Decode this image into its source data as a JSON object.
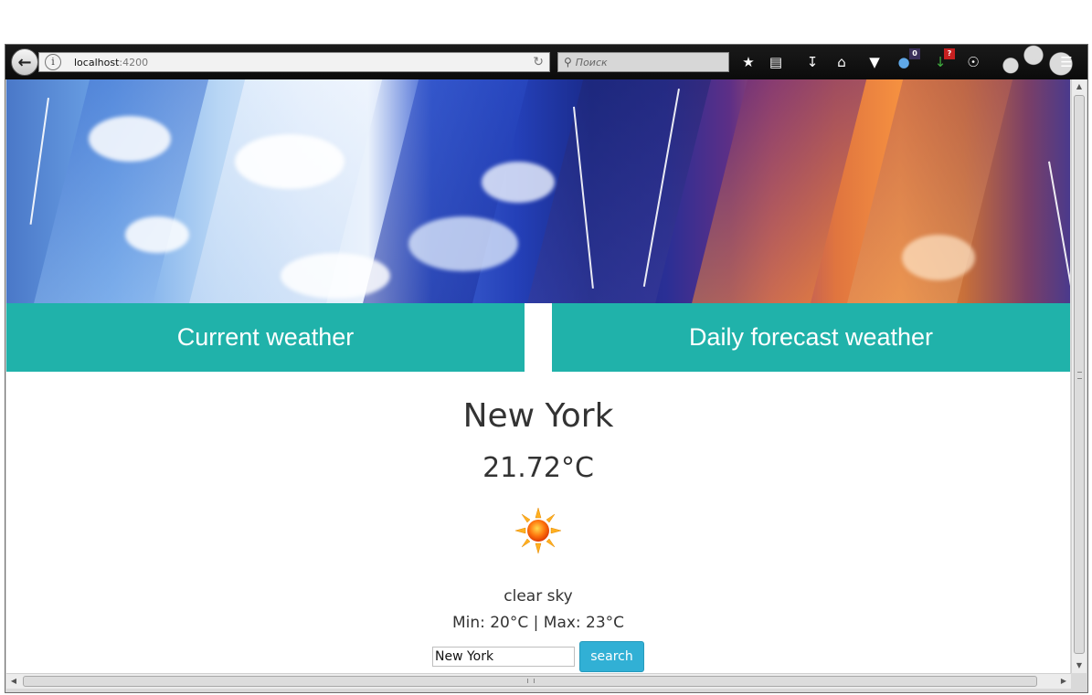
{
  "browser": {
    "url_host": "localhost",
    "url_port": ":4200",
    "search_placeholder": "Поиск",
    "badges": {
      "mail_count": "0",
      "addon_badge": "?"
    }
  },
  "tabs": {
    "current_label": "Current weather",
    "daily_label": "Daily forecast weather"
  },
  "weather": {
    "city": "New York",
    "temperature": "21.72°C",
    "icon": "clear-sky-sun-icon",
    "description": "clear sky",
    "minmax": "Min: 20°C | Max: 23°C"
  },
  "search": {
    "input_value": "New York",
    "button_label": "search"
  },
  "colors": {
    "tab_background": "#20b2aa",
    "search_button": "#31b0d5",
    "toolbar": "#0b0b0b"
  }
}
